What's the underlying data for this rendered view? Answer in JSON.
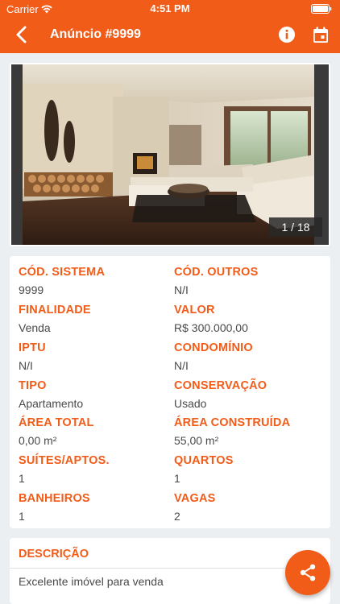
{
  "status_bar": {
    "carrier": "Carrier",
    "time": "4:51 PM"
  },
  "nav": {
    "title": "Anúncio #9999",
    "icons": [
      "back-icon",
      "info-icon",
      "calendar-icon"
    ]
  },
  "gallery": {
    "counter": "1 / 18"
  },
  "details": [
    {
      "label": "CÓD. SISTEMA",
      "value": "9999"
    },
    {
      "label": "CÓD. OUTROS",
      "value": "N/I"
    },
    {
      "label": "FINALIDADE",
      "value": "Venda"
    },
    {
      "label": "VALOR",
      "value": "R$ 300.000,00"
    },
    {
      "label": "IPTU",
      "value": "N/I"
    },
    {
      "label": "CONDOMÍNIO",
      "value": "N/I"
    },
    {
      "label": "TIPO",
      "value": "Apartamento"
    },
    {
      "label": "CONSERVAÇÃO",
      "value": "Usado"
    },
    {
      "label": "ÁREA TOTAL",
      "value": "0,00 m²"
    },
    {
      "label": "ÁREA CONSTRUÍDA",
      "value": "55,00 m²"
    },
    {
      "label": "SUÍTES/APTOS.",
      "value": "1"
    },
    {
      "label": "QUARTOS",
      "value": "1"
    },
    {
      "label": "BANHEIROS",
      "value": "1"
    },
    {
      "label": "VAGAS",
      "value": "2"
    }
  ],
  "description": {
    "title": "DESCRIÇÃO",
    "text": "Excelente imóvel para venda"
  },
  "fab": {
    "icon": "share-icon"
  },
  "colors": {
    "accent": "#f25c19",
    "background": "#eceff2",
    "text": "#4a4a4a"
  }
}
